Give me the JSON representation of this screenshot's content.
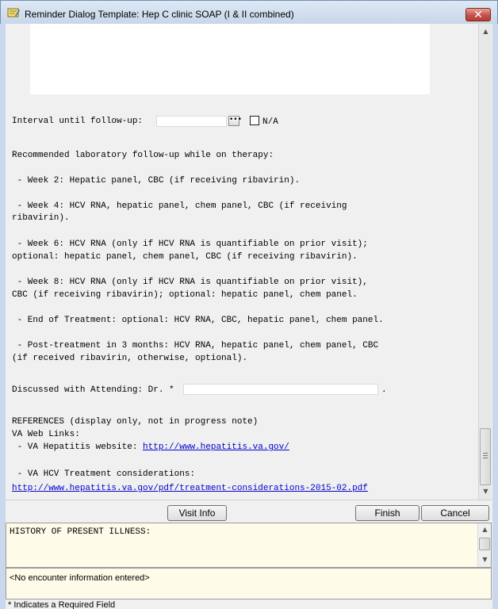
{
  "window": {
    "title": "Reminder Dialog Template: Hep C clinic SOAP (I & II combined)",
    "close_glyph": "✕"
  },
  "content": {
    "interval_label": "Interval until follow-up:",
    "ellipsis_glyph": "•••",
    "na_label": "N/A",
    "lab_heading": "Recommended laboratory follow-up while on therapy:",
    "week2": " - Week 2: Hepatic panel, CBC (if receiving ribavirin).",
    "week4_1": " - Week 4: HCV RNA, hepatic panel, chem panel, CBC (if receiving",
    "week4_2": "ribavirin).",
    "week6_1": " - Week 6: HCV RNA (only if HCV RNA is quantifiable on prior visit);",
    "week6_2": "optional: hepatic panel, chem panel, CBC (if receiving ribavirin).",
    "week8_1": " - Week 8: HCV RNA (only if HCV RNA is quantifiable on prior visit),",
    "week8_2": "CBC (if receiving ribavirin); optional: hepatic panel, chem panel.",
    "eot": " - End of Treatment: optional: HCV RNA, CBC, hepatic panel, chem panel.",
    "post_1": " - Post-treatment in 3 months: HCV RNA, hepatic panel, chem panel, CBC",
    "post_2": "(if received ribavirin, otherwise, optional).",
    "attending_label": "Discussed with Attending: Dr. *",
    "attending_period": ".",
    "references": "REFERENCES (display only, not in progress note)",
    "web_links": "VA Web Links:",
    "hep_site_label": " - VA Hepatitis website: ",
    "hep_site_url": "http://www.hepatitis.va.gov/",
    "treatment_label": " - VA HCV Treatment considerations:",
    "treatment_url": "http://www.hepatitis.va.gov/pdf/treatment-considerations-2015-02.pdf"
  },
  "scrollbar": {
    "up": "▲",
    "down": "▼"
  },
  "buttons": {
    "visit_info": "Visit Info",
    "finish": "Finish",
    "cancel": "Cancel"
  },
  "note": {
    "text": "HISTORY OF PRESENT ILLNESS:"
  },
  "encounter": {
    "text": "<No encounter information entered>"
  },
  "footer": {
    "text": "* Indicates a Required Field"
  }
}
